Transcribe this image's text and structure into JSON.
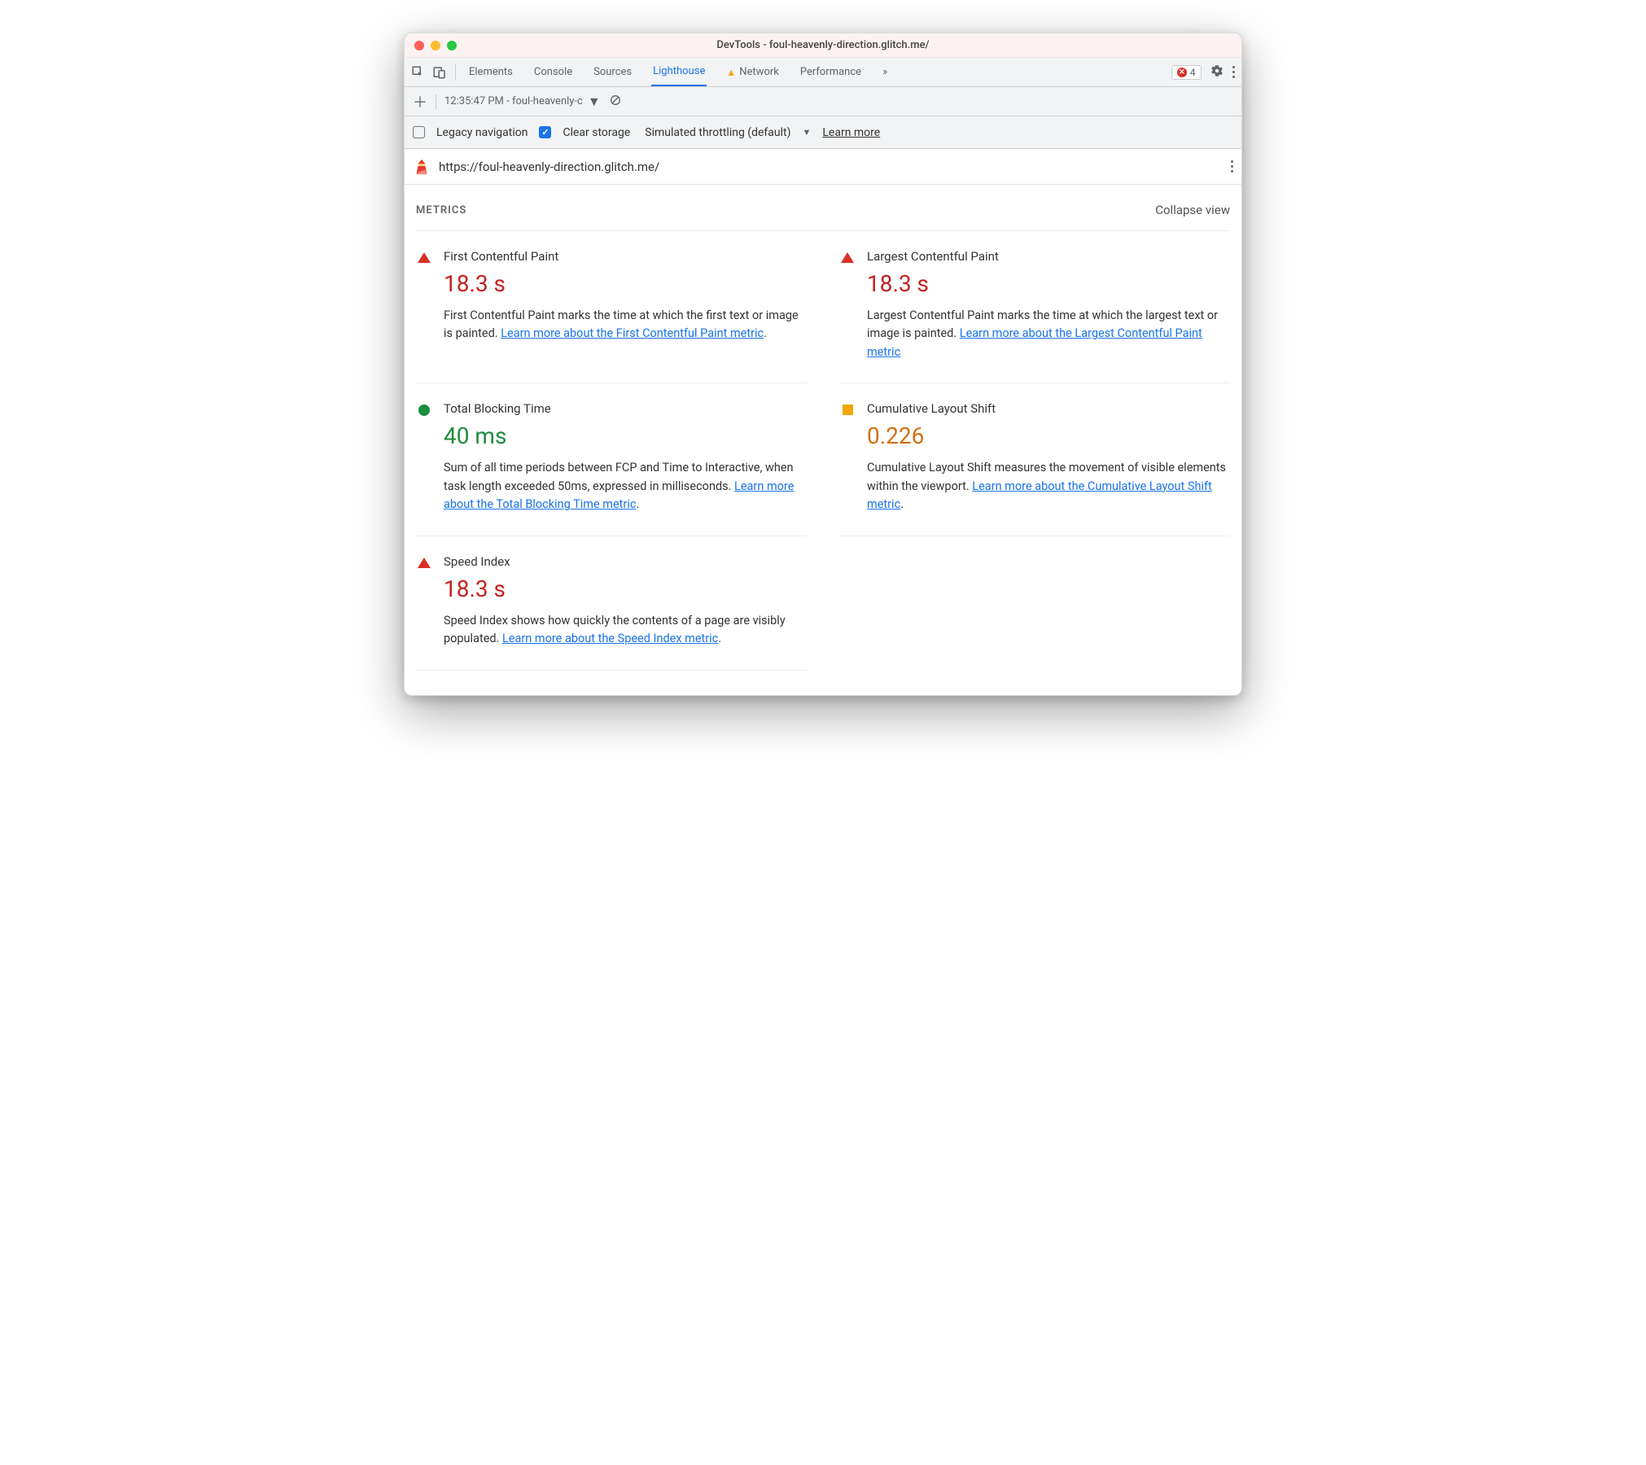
{
  "window": {
    "title": "DevTools - foul-heavenly-direction.glitch.me/"
  },
  "toolbar": {
    "tabs": [
      "Elements",
      "Console",
      "Sources",
      "Lighthouse",
      "Network",
      "Performance"
    ],
    "active_tab": "Lighthouse",
    "error_count": "4"
  },
  "subbar": {
    "report_label": "12:35:47 PM - foul-heavenly-c"
  },
  "options": {
    "legacy_label": "Legacy navigation",
    "legacy_checked": false,
    "clear_label": "Clear storage",
    "clear_checked": true,
    "throttle_label": "Simulated throttling (default)",
    "learn_more": "Learn more"
  },
  "urlbar": {
    "url": "https://foul-heavenly-direction.glitch.me/"
  },
  "section": {
    "title": "METRICS",
    "collapse": "Collapse view"
  },
  "metrics": [
    {
      "name": "First Contentful Paint",
      "value": "18.3 s",
      "status": "red",
      "shape": "triangle",
      "desc": "First Contentful Paint marks the time at which the first text or image is painted. ",
      "link": "Learn more about the First Contentful Paint metric",
      "after": "."
    },
    {
      "name": "Largest Contentful Paint",
      "value": "18.3 s",
      "status": "red",
      "shape": "triangle",
      "desc": "Largest Contentful Paint marks the time at which the largest text or image is painted. ",
      "link": "Learn more about the Largest Contentful Paint metric",
      "after": ""
    },
    {
      "name": "Total Blocking Time",
      "value": "40 ms",
      "status": "green",
      "shape": "circle",
      "desc": "Sum of all time periods between FCP and Time to Interactive, when task length exceeded 50ms, expressed in milliseconds. ",
      "link": "Learn more about the Total Blocking Time metric",
      "after": "."
    },
    {
      "name": "Cumulative Layout Shift",
      "value": "0.226",
      "status": "orange",
      "shape": "square",
      "desc": "Cumulative Layout Shift measures the movement of visible elements within the viewport. ",
      "link": "Learn more about the Cumulative Layout Shift metric",
      "after": "."
    },
    {
      "name": "Speed Index",
      "value": "18.3 s",
      "status": "red",
      "shape": "triangle",
      "desc": "Speed Index shows how quickly the contents of a page are visibly populated. ",
      "link": "Learn more about the Speed Index metric",
      "after": "."
    }
  ]
}
